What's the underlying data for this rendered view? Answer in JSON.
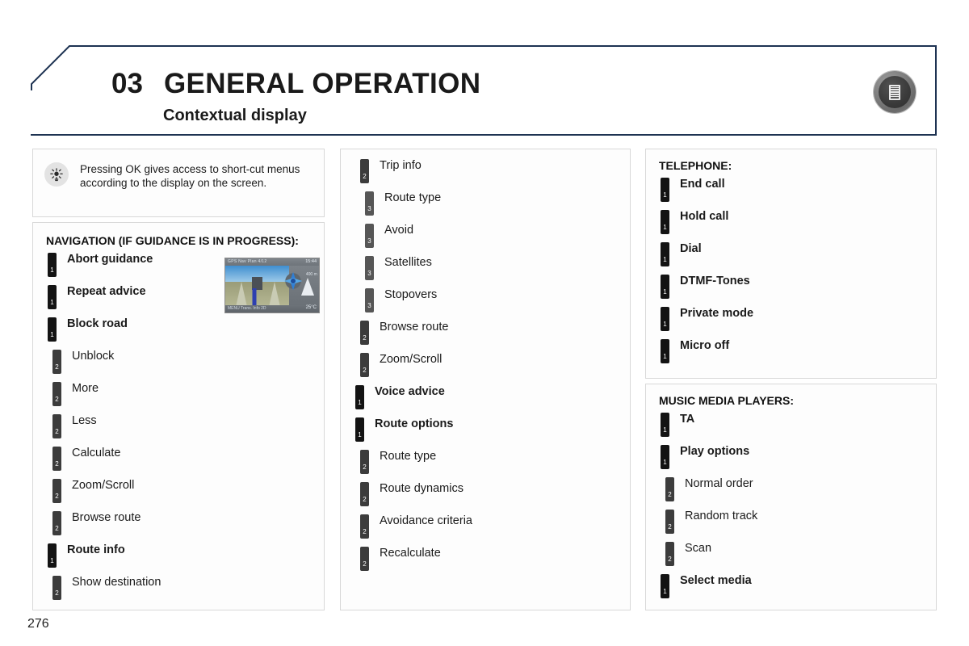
{
  "header": {
    "chapter_number": "03",
    "title": "GENERAL OPERATION",
    "subtitle": "Contextual display",
    "badge_icon": "document-list-icon",
    "border_color": "#1e3352"
  },
  "note": {
    "icon": "sunburst-tip-icon",
    "text": "Pressing OK gives access to short-cut menus according to the display on the screen."
  },
  "nav_screenshot": {
    "icon": "navigation-map-screenshot",
    "status_left": "GPS Nav Plan 4/12",
    "status_right": "15:44",
    "distance": "400 m",
    "footer_left": "MENU    Trans.    Info 2D",
    "footer_right": "25°C"
  },
  "sections": [
    {
      "id": "navigation",
      "heading": "NAVIGATION (IF GUIDANCE IS IN PROGRESS):",
      "items": [
        {
          "label": "Abort guidance",
          "level": 1,
          "marker": "1"
        },
        {
          "label": "Repeat advice",
          "level": 1,
          "marker": "1"
        },
        {
          "label": "Block road",
          "level": 1,
          "marker": "1"
        },
        {
          "label": "Unblock",
          "level": 2,
          "marker": "2"
        },
        {
          "label": "More",
          "level": 2,
          "marker": "2"
        },
        {
          "label": "Less",
          "level": 2,
          "marker": "2"
        },
        {
          "label": "Calculate",
          "level": 2,
          "marker": "2"
        },
        {
          "label": "Zoom/Scroll",
          "level": 2,
          "marker": "2"
        },
        {
          "label": "Browse route",
          "level": 2,
          "marker": "2"
        },
        {
          "label": "Route info",
          "level": 1,
          "marker": "1"
        },
        {
          "label": "Show destination",
          "level": 2,
          "marker": "2"
        }
      ]
    },
    {
      "id": "middle",
      "heading": "",
      "items": [
        {
          "label": "Trip info",
          "level": 2,
          "marker": "2"
        },
        {
          "label": "Route type",
          "level": 3,
          "marker": "3"
        },
        {
          "label": "Avoid",
          "level": 3,
          "marker": "3"
        },
        {
          "label": "Satellites",
          "level": 3,
          "marker": "3"
        },
        {
          "label": "Stopovers",
          "level": 3,
          "marker": "3"
        },
        {
          "label": "Browse route",
          "level": 2,
          "marker": "2"
        },
        {
          "label": "Zoom/Scroll",
          "level": 2,
          "marker": "2"
        },
        {
          "label": "Voice advice",
          "level": 1,
          "marker": "1"
        },
        {
          "label": "Route options",
          "level": 1,
          "marker": "1"
        },
        {
          "label": "Route type",
          "level": 2,
          "marker": "2"
        },
        {
          "label": "Route dynamics",
          "level": 2,
          "marker": "2"
        },
        {
          "label": "Avoidance criteria",
          "level": 2,
          "marker": "2"
        },
        {
          "label": "Recalculate",
          "level": 2,
          "marker": "2"
        }
      ]
    },
    {
      "id": "telephone",
      "heading": "TELEPHONE:",
      "items": [
        {
          "label": "End call",
          "level": 1,
          "marker": "1"
        },
        {
          "label": "Hold call",
          "level": 1,
          "marker": "1"
        },
        {
          "label": "Dial",
          "level": 1,
          "marker": "1"
        },
        {
          "label": "DTMF-Tones",
          "level": 1,
          "marker": "1"
        },
        {
          "label": "Private mode",
          "level": 1,
          "marker": "1"
        },
        {
          "label": "Micro off",
          "level": 1,
          "marker": "1"
        }
      ]
    },
    {
      "id": "music",
      "heading": "MUSIC MEDIA PLAYERS:",
      "items": [
        {
          "label": "TA",
          "level": 1,
          "marker": "1"
        },
        {
          "label": "Play options",
          "level": 1,
          "marker": "1"
        },
        {
          "label": "Normal order",
          "level": 2,
          "marker": "2"
        },
        {
          "label": "Random track",
          "level": 2,
          "marker": "2"
        },
        {
          "label": "Scan",
          "level": 2,
          "marker": "2"
        },
        {
          "label": "Select media",
          "level": 1,
          "marker": "1"
        }
      ]
    }
  ],
  "footer": {
    "page_number": "276"
  },
  "colors": {
    "level1_marker": "#131313",
    "level2_marker": "#3c3c3c",
    "level3_marker": "#565656",
    "header_border": "#1e3352",
    "panel_border": "#d8d8d8"
  }
}
